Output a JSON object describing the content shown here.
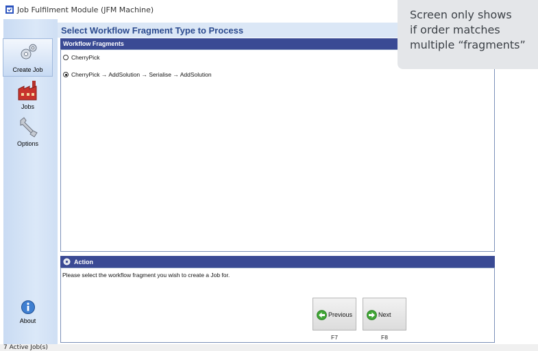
{
  "window": {
    "title": "Job Fulfilment Module (JFM Machine)"
  },
  "nav": {
    "items": [
      {
        "label": "Create Job",
        "icon": "gears-icon",
        "active": true
      },
      {
        "label": "Jobs",
        "icon": "factory-icon",
        "active": false
      },
      {
        "label": "Options",
        "icon": "wrench-icon",
        "active": false
      },
      {
        "label": "About",
        "icon": "info-icon",
        "active": false
      }
    ]
  },
  "header": {
    "title": "Select Workflow Fragment Type to Process"
  },
  "fragments": {
    "panel_title": "Workflow Fragments",
    "options": [
      {
        "label": "CherryPick",
        "selected": false
      },
      {
        "label": "CherryPick → AddSolution → Serialise → AddSolution",
        "selected": true
      }
    ]
  },
  "action": {
    "panel_title": "Action",
    "message": "Please select the workflow fragment you wish to create a Job for."
  },
  "buttons": {
    "previous": {
      "label": "Previous",
      "key": "F7"
    },
    "next": {
      "label": "Next",
      "key": "F8"
    }
  },
  "status_bar": {
    "text": "7 Active Job(s)"
  },
  "callout": {
    "text": "Screen only shows\nif order matches\nmultiple “fragments”"
  },
  "colors": {
    "panel_header": "#3a4a94",
    "accent_green": "#3fa535",
    "header_text": "#2b4a8e"
  }
}
